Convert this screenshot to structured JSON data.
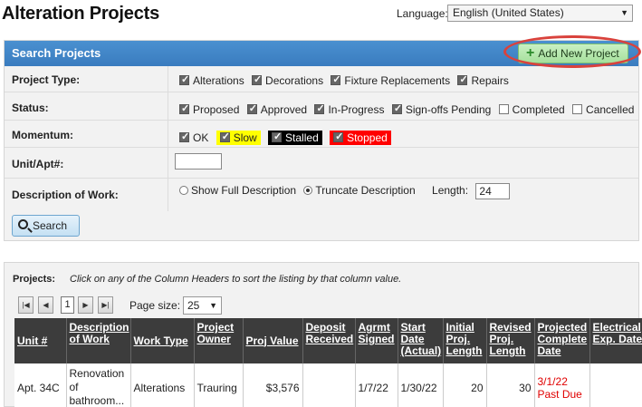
{
  "page": {
    "title": "Alteration Projects",
    "language_label": "Language:",
    "language_value": "English (United States)"
  },
  "search": {
    "header": "Search Projects",
    "add_button": "Add New Project",
    "project_type": {
      "label": "Project Type:",
      "options": [
        {
          "label": "Alterations",
          "checked": true
        },
        {
          "label": "Decorations",
          "checked": true
        },
        {
          "label": "Fixture Replacements",
          "checked": true
        },
        {
          "label": "Repairs",
          "checked": true
        }
      ]
    },
    "status": {
      "label": "Status:",
      "options": [
        {
          "label": "Proposed",
          "checked": true
        },
        {
          "label": "Approved",
          "checked": true
        },
        {
          "label": "In-Progress",
          "checked": true
        },
        {
          "label": "Sign-offs Pending",
          "checked": true
        },
        {
          "label": "Completed",
          "checked": false
        },
        {
          "label": "Cancelled",
          "checked": false
        }
      ]
    },
    "momentum": {
      "label": "Momentum:",
      "options": [
        {
          "label": "OK",
          "checked": true,
          "color": "#ffffff"
        },
        {
          "label": "Slow",
          "checked": true,
          "color": "#ffff00"
        },
        {
          "label": "Stalled",
          "checked": true,
          "color": "#000000"
        },
        {
          "label": "Stopped",
          "checked": true,
          "color": "#ff0000"
        }
      ]
    },
    "unit_label": "Unit/Apt#:",
    "unit_value": "",
    "description": {
      "label": "Description of Work:",
      "show_full": "Show Full Description",
      "truncate": "Truncate Description",
      "selected": "truncate",
      "length_label": "Length:",
      "length_value": "24"
    },
    "search_button": "Search"
  },
  "projects": {
    "label": "Projects:",
    "hint": "Click on any of the Column Headers to sort the listing by that column value.",
    "current_page": "1",
    "page_size_label": "Page size:",
    "page_size_value": "25",
    "columns": [
      "Unit #",
      "Description of Work",
      "Work Type",
      "Project Owner",
      "Proj Value",
      "Deposit Received",
      "Agrmt Signed",
      "Start Date (Actual)",
      "Initial Proj. Length",
      "Revised Proj. Length",
      "Projected Complete Date",
      "Electrical Exp. Date"
    ],
    "rows": [
      {
        "unit": "Apt. 34C",
        "description": "Renovation of bathroom...",
        "work_type": "Alterations",
        "owner": "Trauring",
        "value": "$3,576",
        "deposit": "",
        "agrmt": "1/7/22",
        "start": "1/30/22",
        "initial": "20",
        "revised": "30",
        "projected": "3/1/22",
        "projected_note": "Past Due",
        "electrical": ""
      }
    ]
  }
}
